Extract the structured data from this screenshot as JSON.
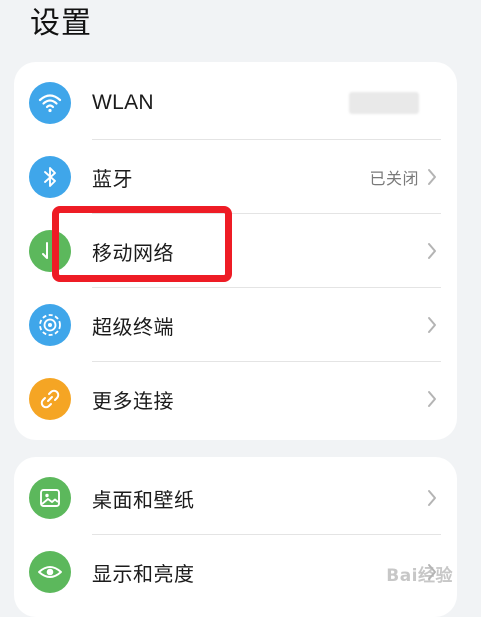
{
  "header": {
    "title": "设置"
  },
  "group1": [
    {
      "label": "WLAN",
      "icon": "wifi-icon",
      "color": "#3fa6ea",
      "status": ""
    },
    {
      "label": "蓝牙",
      "icon": "bluetooth-icon",
      "color": "#3fa6ea",
      "status": "已关闭"
    },
    {
      "label": "移动网络",
      "icon": "mobile-network-icon",
      "color": "#5cb85c",
      "status": ""
    },
    {
      "label": "超级终端",
      "icon": "super-device-icon",
      "color": "#3fa6ea",
      "status": ""
    },
    {
      "label": "更多连接",
      "icon": "link-icon",
      "color": "#f5a524",
      "status": ""
    }
  ],
  "group2": [
    {
      "label": "桌面和壁纸",
      "icon": "wallpaper-icon",
      "color": "#5cb85c",
      "status": ""
    },
    {
      "label": "显示和亮度",
      "icon": "eye-icon",
      "color": "#5cb85c",
      "status": ""
    }
  ],
  "watermark": "Bai经验"
}
